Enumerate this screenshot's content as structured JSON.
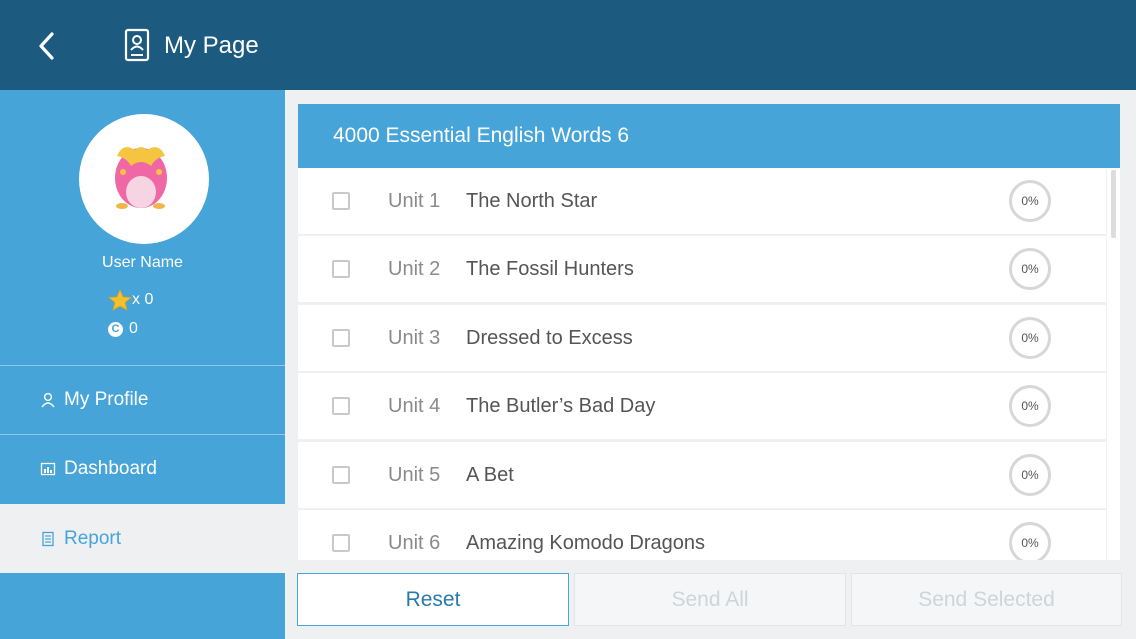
{
  "header": {
    "title": "My Page"
  },
  "profile": {
    "user_name": "User Name",
    "stars": "x 0",
    "coins": "0"
  },
  "menu": [
    {
      "label": "My Profile",
      "icon": "user-icon",
      "active": false
    },
    {
      "label": "Dashboard",
      "icon": "dashboard-icon",
      "active": false
    },
    {
      "label": "Report",
      "icon": "report-icon",
      "active": true
    }
  ],
  "course": {
    "title": "4000 Essential English Words 6",
    "units": [
      {
        "unit": "Unit 1",
        "title": "The North Star",
        "progress": "0%"
      },
      {
        "unit": "Unit 2",
        "title": "The Fossil Hunters",
        "progress": "0%"
      },
      {
        "unit": "Unit 3",
        "title": "Dressed to Excess",
        "progress": "0%"
      },
      {
        "unit": "Unit 4",
        "title": "The Butler’s Bad Day",
        "progress": "0%"
      },
      {
        "unit": "Unit 5",
        "title": "A Bet",
        "progress": "0%"
      },
      {
        "unit": "Unit 6",
        "title": "Amazing Komodo Dragons",
        "progress": "0%"
      }
    ]
  },
  "buttons": {
    "reset": "Reset",
    "send_all": "Send All",
    "send_selected": "Send Selected"
  },
  "colors": {
    "header": "#1d5a7f",
    "accent": "#46a4d8",
    "background": "#eef0f2"
  }
}
